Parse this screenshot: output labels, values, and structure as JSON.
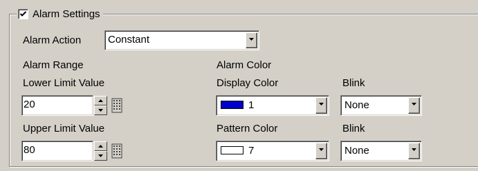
{
  "alarm_settings": {
    "title": "Alarm Settings",
    "checked": true
  },
  "alarm_action": {
    "label": "Alarm Action",
    "value": "Constant"
  },
  "alarm_range": {
    "heading": "Alarm Range",
    "lower_label": "Lower Limit Value",
    "lower_value": "20",
    "upper_label": "Upper Limit Value",
    "upper_value": "80"
  },
  "alarm_color": {
    "heading": "Alarm Color",
    "display_label": "Display Color",
    "display_value": "1",
    "display_swatch": "#0000cc",
    "pattern_label": "Pattern Color",
    "pattern_value": "7",
    "pattern_swatch": "#ffffff",
    "blink_label_1": "Blink",
    "blink_value_1": "None",
    "blink_label_2": "Blink",
    "blink_value_2": "None"
  }
}
